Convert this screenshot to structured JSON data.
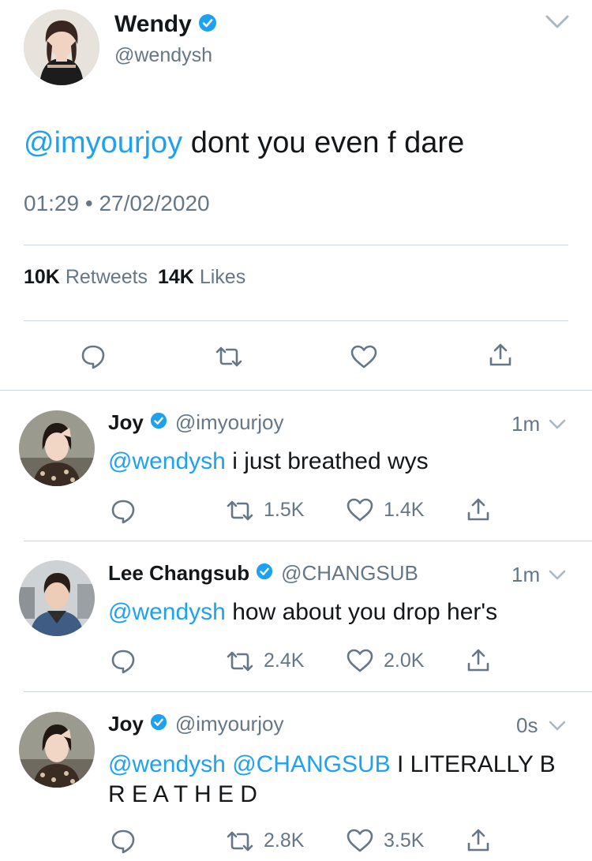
{
  "main_tweet": {
    "name": "Wendy",
    "handle": "@wendysh",
    "mention": "@imyourjoy",
    "text": " dont you even f dare",
    "time": "01:29",
    "dot": "•",
    "date": "27/02/2020",
    "retweets_count": "10K",
    "retweets_label": "Retweets",
    "likes_count": "14K",
    "likes_label": "Likes"
  },
  "replies": [
    {
      "name": "Joy",
      "handle": "@imyourjoy",
      "time": "1m",
      "mentions": "@wendysh",
      "text": " i just breathed wys",
      "retweets": "1.5K",
      "likes": "1.4K"
    },
    {
      "name": "Lee Changsub",
      "handle": "@CHANGSUB",
      "time": "1m",
      "mentions": "@wendysh",
      "text": " how about you drop her's",
      "retweets": "2.4K",
      "likes": "2.0K"
    },
    {
      "name": "Joy",
      "handle": "@imyourjoy",
      "time": "0s",
      "mentions": "@wendysh @CHANGSUB",
      "text": " I LITERALLY B",
      "text_line2": "R E A T H E D",
      "retweets": "2.8K",
      "likes": "3.5K"
    }
  ],
  "colors": {
    "accent": "#1da1f2",
    "text": "#14171a",
    "secondary": "#657786",
    "divider": "#ccd6dd"
  },
  "icons": [
    "verified-badge-icon",
    "chevron-down-icon",
    "reply-icon",
    "retweet-icon",
    "like-icon",
    "share-icon"
  ]
}
